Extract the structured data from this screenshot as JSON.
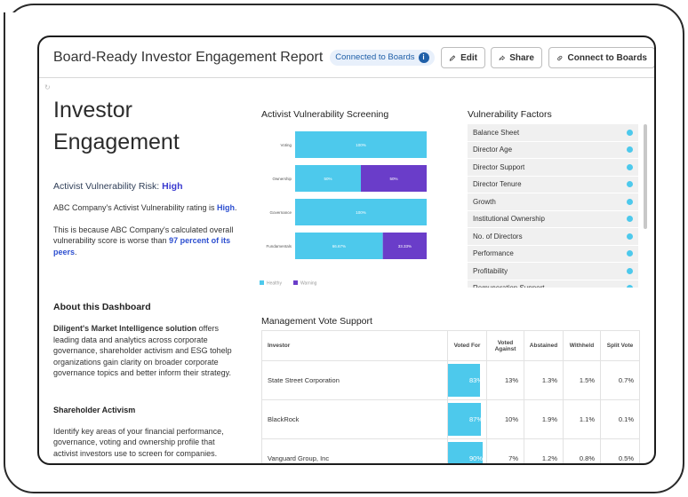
{
  "header": {
    "title": "Board-Ready Investor Engagement Report",
    "badge": "Connected to Boards",
    "edit": "Edit",
    "share": "Share",
    "connect": "Connect to Boards"
  },
  "left": {
    "title_line1": "Investor",
    "title_line2": "Engagement",
    "risk_label": "Activist Vulnerability Risk: ",
    "risk_value": "High",
    "rating_text": "ABC Company's Activist Vulnerability rating is ",
    "rating_value": "High",
    "rating_end": ".",
    "because_text": "This is because ABC Company's calculated overall vulnerability score is worse than ",
    "because_value": "97 percent of its peers",
    "because_end": ".",
    "about_title": "About this Dashboard",
    "about_bold": "Diligent's Market Intelligence solution",
    "about_text": " offers leading data and analytics across corporate governance, shareholder activism and ESG tohelp organizations gain clarity on broader corporate governance topics and better inform their strategy.",
    "sh_title": "Shareholder Activism",
    "sh_text": "Identify key areas of your financial performance, governance, voting and ownership profile that activist investors use to screen for companies."
  },
  "chart_data": {
    "type": "bar",
    "stacked": true,
    "orientation": "horizontal",
    "title": "Activist Vulnerability Screening",
    "categories": [
      "Voting",
      "Ownership",
      "Governance",
      "Fundamentals"
    ],
    "series": [
      {
        "name": "Healthy",
        "color": "#4dc9ec",
        "values": [
          100,
          50,
          100,
          66.67
        ],
        "labels": [
          "100%",
          "50%",
          "100%",
          "66.67%"
        ]
      },
      {
        "name": "Warning",
        "color": "#6a3dc9",
        "values": [
          0,
          50,
          0,
          33.33
        ],
        "labels": [
          "",
          "50%",
          "",
          "33.33%"
        ]
      }
    ],
    "xlim": [
      0,
      100
    ],
    "legend": "bottom-left"
  },
  "vuln_factors": {
    "title": "Vulnerability Factors",
    "items": [
      "Balance Sheet",
      "Director Age",
      "Director Support",
      "Director Tenure",
      "Growth",
      "Institutional Ownership",
      "No. of Directors",
      "Performance",
      "Profitability",
      "Remuneration Support"
    ]
  },
  "mvs": {
    "title": "Management Vote Support",
    "headers": [
      "Investor",
      "Voted For",
      "Voted Against",
      "Abstained",
      "Withheld",
      "Split Vote"
    ],
    "rows": [
      {
        "investor": "State Street Corporation",
        "for": "83%",
        "for_value": 83,
        "against": "13%",
        "abstained": "1.3%",
        "withheld": "1.5%",
        "split": "0.7%"
      },
      {
        "investor": "BlackRock",
        "for": "87%",
        "for_value": 87,
        "against": "10%",
        "abstained": "1.9%",
        "withheld": "1.1%",
        "split": "0.1%"
      },
      {
        "investor": "Vanguard Group, Inc",
        "for": "90%",
        "for_value": 90,
        "against": "7%",
        "abstained": "1.2%",
        "withheld": "0.8%",
        "split": "0.5%"
      }
    ]
  }
}
